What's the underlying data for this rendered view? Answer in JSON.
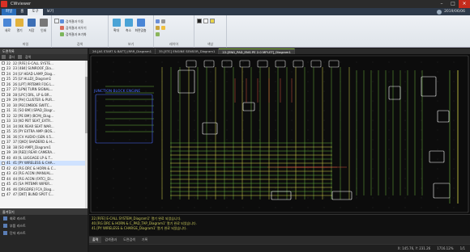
{
  "window": {
    "title": "CWviewer",
    "minimize": "–",
    "maximize": "□",
    "close": "×"
  },
  "ribbon_tabs": [
    "파일",
    "홈",
    "도구",
    "보기"
  ],
  "ribbon_active_tab": 2,
  "user": {
    "date": "2019/06/06"
  },
  "ribbon": {
    "groups": [
      {
        "label": "파일",
        "buttons": [
          "새로",
          "열기",
          "저장",
          "인쇄"
        ]
      },
      {
        "label": "검색",
        "small": [
          "검색결과 이동",
          "검색결과 지우기",
          "검색결과 초기화"
        ]
      },
      {
        "label": "보기",
        "buttons": [
          "확대",
          "축소",
          "화면맞춤"
        ]
      },
      {
        "label": "레이어",
        "buttons": []
      },
      {
        "label": "색상",
        "buttons": []
      }
    ]
  },
  "left_panel": {
    "title": "도면목록",
    "toolbar": [
      "폴더",
      "검색"
    ],
    "rows": [
      {
        "num": "22",
        "name": "22 [RFE] E-CALL SYSTE..."
      },
      {
        "num": "23",
        "name": "23 [484] SUNROOF_Dia..."
      },
      {
        "num": "24",
        "name": "24 [LY HEAD LAMP_Diag..."
      },
      {
        "num": "25",
        "name": "25 [LY HLLD]_Diagram1"
      },
      {
        "num": "26",
        "name": "26 [LPT] PRTBMR FOG L..."
      },
      {
        "num": "27",
        "name": "27 [LPN] TURN SIGNAL..."
      },
      {
        "num": "28",
        "name": "28 [LPC] DRL, LP & BR..."
      },
      {
        "num": "29",
        "name": "29 [PH] CLUSTER & PUR..."
      },
      {
        "num": "30",
        "name": "30 [PECOMBOE SWITC..."
      },
      {
        "num": "31",
        "name": "31 [SO BM] (SPAD_Diagr..."
      },
      {
        "num": "32",
        "name": "32 [PE BM] (BCM)_Diag..."
      },
      {
        "num": "33",
        "name": "33 [KO PBT SEAT_EXTR..."
      },
      {
        "num": "34",
        "name": "34 [KK REAR SEAT WAR..."
      },
      {
        "num": "35",
        "name": "35 [PY EXTRA AMP (BOS..."
      },
      {
        "num": "36",
        "name": "36 [CV AUDIO (GEN 4.5..."
      },
      {
        "num": "37",
        "name": "37 [QKO] SHADERD & H..."
      },
      {
        "num": "38",
        "name": "38 [SO AMP]_Diagram1"
      },
      {
        "num": "39",
        "name": "39 [RED] REAR CAMERA..."
      },
      {
        "num": "40",
        "name": "40 [IL LUGGAGE LP & T..."
      },
      {
        "num": "41",
        "name": "41 [PY WIRELESS & CHA..."
      },
      {
        "num": "42",
        "name": "42 [RG DRC & HORN & C..."
      },
      {
        "num": "43",
        "name": "43 [RG ACON (MANUAL..."
      },
      {
        "num": "44",
        "name": "44 [RG ACON (FATC)_Di..."
      },
      {
        "num": "45",
        "name": "45 [SA PRTBMR WIPER..."
      },
      {
        "num": "46",
        "name": "46 [DRGDRE] FCA_Diag..."
      },
      {
        "num": "47",
        "name": "47 [DKT] BLIND SPOT C..."
      }
    ],
    "selected_index": 19
  },
  "bookmark_panel": {
    "title": "즐겨찾기",
    "items": [
      "회로 리스트",
      "부품 리스트",
      "단자 리스트"
    ]
  },
  "doc_tabs": [
    "26.[AS START & BATT] (RRR_Diagram1",
    "35.[ETC] ENGINE SENSOR_Diagram1",
    "22.[ENG_PAD_ENG PE 2.0 MPI-ET]_Diagram1"
  ],
  "doc_active_tab": 2,
  "diagram": {
    "label": "JUNCTION BLOCK ENGINE"
  },
  "output": [
    "22.[RFE] E-CALL SYSTEM_Diagram1' 열기 완료 되었습니다.",
    "40.[RG DRC & HORN & C_PAD_TAP_Diagram1' 열기 완료 되었습니다.",
    "41.[PY WIRELESS & CHARGE_Diagram1' 열기 완료 되었습니다."
  ],
  "output_tabs": [
    "출력",
    "검색결과",
    "도면검색",
    "기록"
  ],
  "output_active_tab": 0,
  "status": {
    "coords": "X: 145.76, Y: 231.26",
    "zoom": "1716.12%",
    "page": "1/1"
  },
  "colors": {
    "accent": "#2a6ebb",
    "diagram_bg": "#0c0c0c",
    "wire_green": "#6bb33f",
    "wire_yellow": "#d8d84a",
    "selection": "#cfe2ff"
  }
}
